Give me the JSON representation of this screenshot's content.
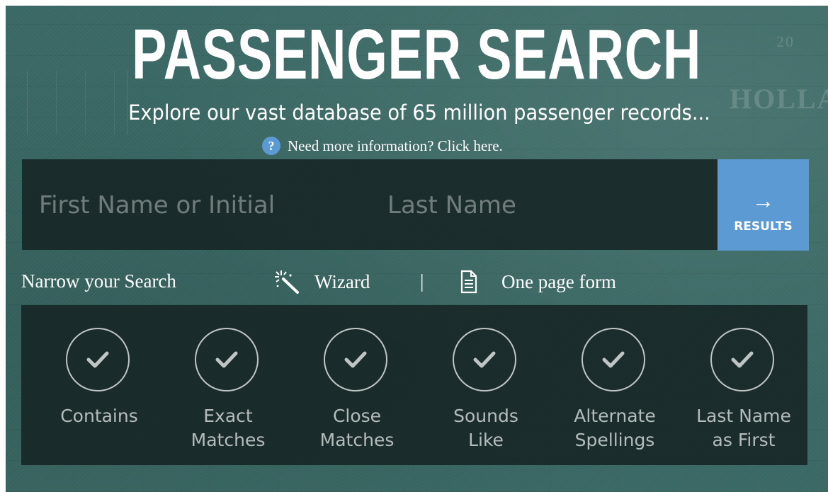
{
  "header": {
    "title": "PASSENGER SEARCH",
    "subtitle": "Explore our vast database of 65 million passenger records...",
    "help_link": "Need more information? Click here."
  },
  "search": {
    "first_name_placeholder": "First Name or Initial",
    "last_name_placeholder": "Last Name",
    "results_label": "RESULTS",
    "results_arrow": "→"
  },
  "narrow": {
    "label": "Narrow your Search",
    "wizard_label": "Wizard",
    "divider": "|",
    "form_label": "One page form"
  },
  "options": [
    {
      "label_line1": "Contains",
      "label_line2": "",
      "checked": true
    },
    {
      "label_line1": "Exact",
      "label_line2": "Matches",
      "checked": true
    },
    {
      "label_line1": "Close",
      "label_line2": "Matches",
      "checked": true
    },
    {
      "label_line1": "Sounds",
      "label_line2": "Like",
      "checked": true
    },
    {
      "label_line1": "Alternate",
      "label_line2": "Spellings",
      "checked": true
    },
    {
      "label_line1": "Last Name",
      "label_line2": "as First",
      "checked": true
    }
  ],
  "colors": {
    "background": "#3a6864",
    "panel": "#162424",
    "accent": "#5b9ad2"
  },
  "icons": {
    "help": "question-circle-icon",
    "wizard": "magic-wand-icon",
    "form": "document-icon",
    "results": "arrow-right-icon",
    "option": "checkmark-icon"
  }
}
